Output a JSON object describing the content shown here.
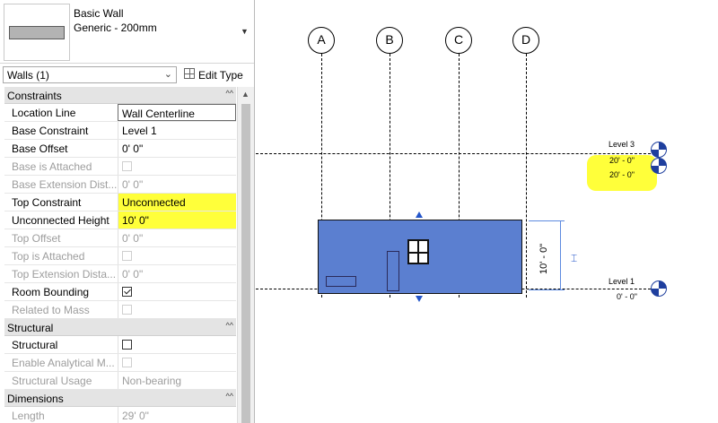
{
  "type_selector": {
    "family": "Basic Wall",
    "type": "Generic - 200mm"
  },
  "filter": {
    "label": "Walls (1)",
    "edit_type": "Edit Type"
  },
  "groups": {
    "constraints": "Constraints",
    "structural": "Structural",
    "dimensions": "Dimensions"
  },
  "constraints": [
    {
      "name": "Location Line",
      "value": "Wall Centerline"
    },
    {
      "name": "Base Constraint",
      "value": "Level 1"
    },
    {
      "name": "Base Offset",
      "value": "0'  0\""
    },
    {
      "name": "Base is Attached",
      "value": ""
    },
    {
      "name": "Base Extension Dist...",
      "value": "0'  0\""
    },
    {
      "name": "Top Constraint",
      "value": "Unconnected"
    },
    {
      "name": "Unconnected Height",
      "value": "10'  0\""
    },
    {
      "name": "Top Offset",
      "value": "0'  0\""
    },
    {
      "name": "Top is Attached",
      "value": ""
    },
    {
      "name": "Top Extension Dista...",
      "value": "0'  0\""
    },
    {
      "name": "Room Bounding",
      "value": ""
    },
    {
      "name": "Related to Mass",
      "value": ""
    }
  ],
  "structural": [
    {
      "name": "Structural",
      "value": ""
    },
    {
      "name": "Enable Analytical M...",
      "value": ""
    },
    {
      "name": "Structural Usage",
      "value": "Non-bearing"
    }
  ],
  "dimensions": [
    {
      "name": "Length",
      "value": "29'  0\""
    }
  ],
  "grids": [
    "A",
    "B",
    "C",
    "D"
  ],
  "levels": {
    "level3": {
      "name": "Level 3",
      "elev": "20' - 0\"",
      "elev2": "20' - 0\""
    },
    "level1": {
      "name": "Level 1",
      "elev": "0' - 0\""
    }
  },
  "temp_dimension": "10' - 0\"",
  "highlight_color": "#ffff3a",
  "wall_color": "#5b7fd0"
}
